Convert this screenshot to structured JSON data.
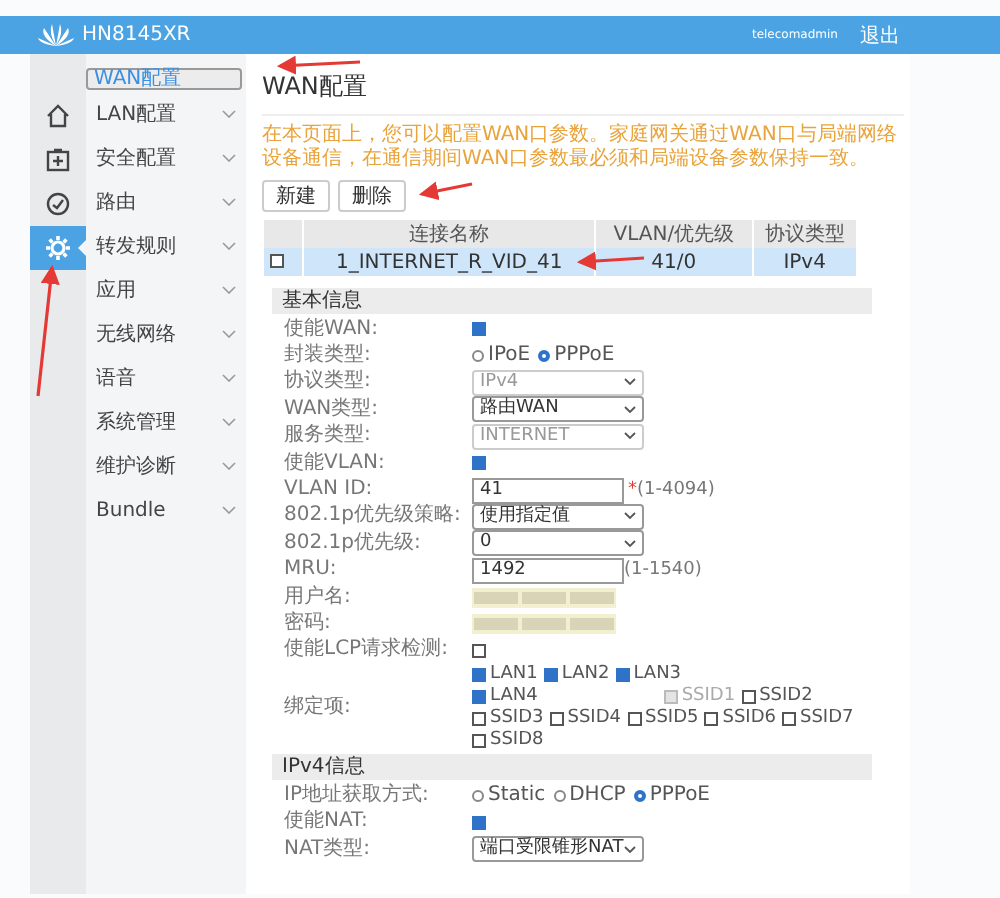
{
  "header": {
    "product": "HN8145XR",
    "user": "telecomadmin",
    "logout": "退出"
  },
  "icon_bar": [
    {
      "kind": "home",
      "selected": false
    },
    {
      "kind": "box",
      "selected": false
    },
    {
      "kind": "gauge",
      "selected": false
    },
    {
      "kind": "gear",
      "selected": true
    }
  ],
  "menu": [
    {
      "label": "WAN配置",
      "kind": "sub",
      "selected": true
    },
    {
      "label": "LAN配置",
      "kind": "group",
      "selected": false
    },
    {
      "label": "安全配置",
      "kind": "group",
      "selected": false
    },
    {
      "label": "路由",
      "kind": "group",
      "selected": false
    },
    {
      "label": "转发规则",
      "kind": "group",
      "selected": false
    },
    {
      "label": "应用",
      "kind": "group",
      "selected": false
    },
    {
      "label": "无线网络",
      "kind": "group",
      "selected": false
    },
    {
      "label": "语音",
      "kind": "group",
      "selected": false
    },
    {
      "label": "系统管理",
      "kind": "group",
      "selected": false
    },
    {
      "label": "维护诊断",
      "kind": "group",
      "selected": false
    },
    {
      "label": "Bundle",
      "kind": "group",
      "selected": false
    }
  ],
  "page_title": "WAN配置",
  "notice": "在本页面上，您可以配置WAN口参数。家庭网关通过WAN口与局端网络设备通信，在通信期间WAN口参数最必须和局端设备参数保持一致。",
  "buttons": [
    "新建",
    "删除"
  ],
  "table": {
    "columns": [
      "连接名称",
      "VLAN/优先级",
      "协议类型"
    ],
    "rows": [
      {
        "checked": false,
        "selected": true,
        "cells": [
          "1_INTERNET_R_VID_41",
          "41/0",
          "IPv4"
        ]
      }
    ]
  },
  "sections": [
    {
      "title": "基本信息",
      "fields": [
        {
          "kind": "checkbox",
          "label": "使能WAN:",
          "checked": true
        },
        {
          "kind": "radio",
          "label": "封装类型:",
          "options": [
            {
              "label": "IPoE",
              "selected": false
            },
            {
              "label": "PPPoE",
              "selected": true
            }
          ]
        },
        {
          "kind": "select",
          "label": "协议类型:",
          "value": "IPv4",
          "disabled": true
        },
        {
          "kind": "select",
          "label": "WAN类型:",
          "value": "路由WAN",
          "disabled": false
        },
        {
          "kind": "select",
          "label": "服务类型:",
          "value": "INTERNET",
          "disabled": true
        },
        {
          "kind": "checkbox",
          "label": "使能VLAN:",
          "checked": true
        },
        {
          "kind": "input",
          "label": "VLAN ID:",
          "value": "41",
          "mark": "*",
          "hint": "(1-4094)"
        },
        {
          "kind": "select",
          "label": "802.1p优先级策略:",
          "value": "使用指定值",
          "disabled": false
        },
        {
          "kind": "select",
          "label": "802.1p优先级:",
          "value": "0",
          "disabled": false
        },
        {
          "kind": "input",
          "label": "MRU:",
          "value": "1492",
          "hint": "(1-1540)"
        },
        {
          "kind": "masked",
          "label": "用户名:"
        },
        {
          "kind": "masked",
          "label": "密码:"
        },
        {
          "kind": "checkbox",
          "label": "使能LCP请求检测:",
          "checked": false
        },
        {
          "kind": "checkgroup",
          "label": "绑定项:",
          "options": [
            {
              "label": "LAN1",
              "checked": true,
              "disabled": false
            },
            {
              "label": "LAN2",
              "checked": true,
              "disabled": false
            },
            {
              "label": "LAN3",
              "checked": true,
              "disabled": false
            },
            {
              "label": "LAN4",
              "checked": true,
              "disabled": false
            },
            {
              "label": "SSID1",
              "checked": false,
              "disabled": true
            },
            {
              "label": "SSID2",
              "checked": false,
              "disabled": false
            },
            {
              "label": "SSID3",
              "checked": false,
              "disabled": false
            },
            {
              "label": "SSID4",
              "checked": false,
              "disabled": false
            },
            {
              "label": "SSID5",
              "checked": false,
              "disabled": false
            },
            {
              "label": "SSID6",
              "checked": false,
              "disabled": false
            },
            {
              "label": "SSID7",
              "checked": false,
              "disabled": false
            },
            {
              "label": "SSID8",
              "checked": false,
              "disabled": false
            }
          ]
        }
      ]
    },
    {
      "title": "IPv4信息",
      "fields": [
        {
          "kind": "radio",
          "label": "IP地址获取方式:",
          "options": [
            {
              "label": "Static",
              "selected": false
            },
            {
              "label": "DHCP",
              "selected": false
            },
            {
              "label": "PPPoE",
              "selected": true
            }
          ]
        },
        {
          "kind": "checkbox",
          "label": "使能NAT:",
          "checked": true
        },
        {
          "kind": "select",
          "label": "NAT类型:",
          "value": "端口受限锥形NAT",
          "disabled": false
        }
      ]
    }
  ]
}
